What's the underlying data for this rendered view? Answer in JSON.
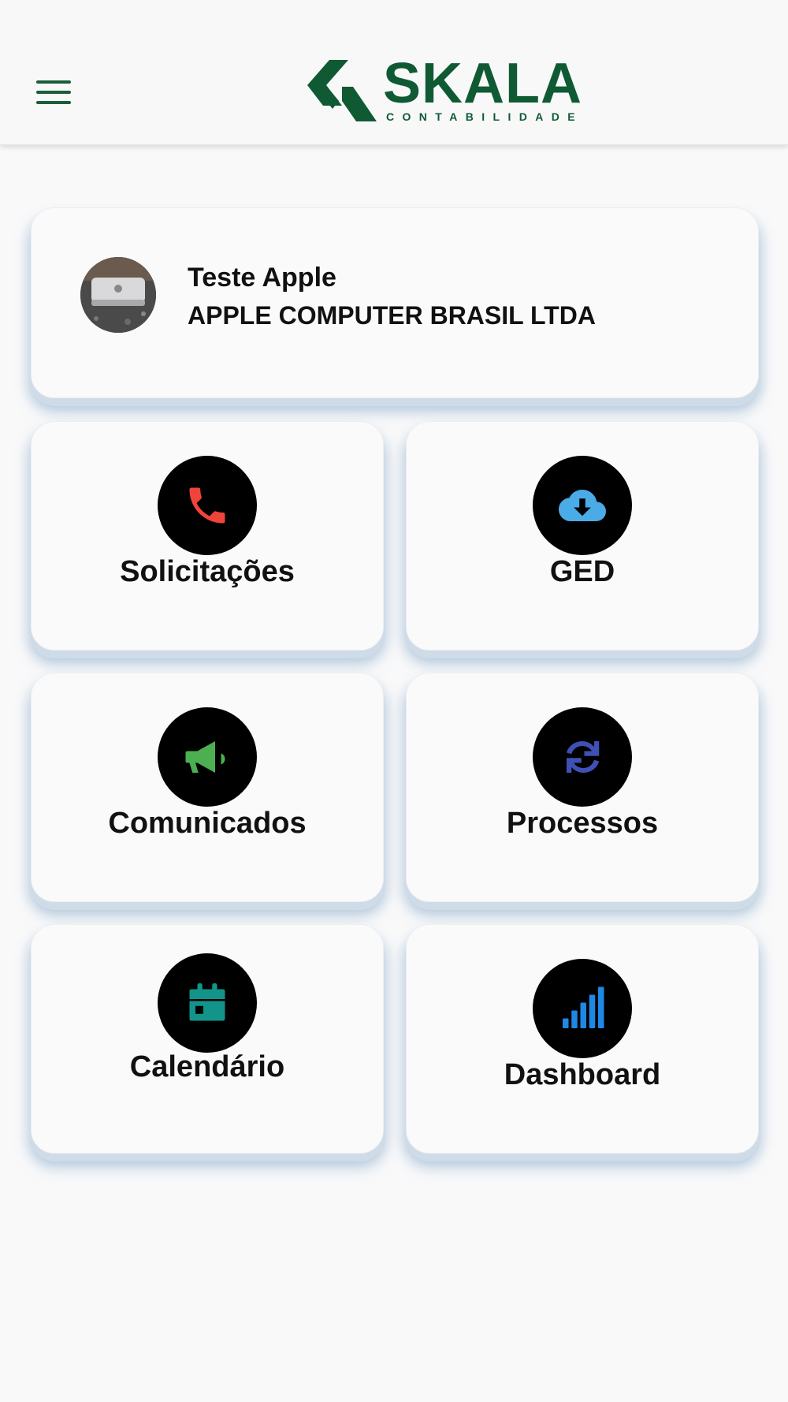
{
  "header": {
    "menu_icon": "hamburger-menu-icon",
    "logo": {
      "title": "SKALA",
      "subtitle": "CONTABILIDADE",
      "color": "#0f5a33"
    }
  },
  "profile": {
    "name": "Teste Apple",
    "company": "APPLE COMPUTER BRASIL LTDA",
    "avatar_icon": "mac-mini-photo"
  },
  "tiles": [
    {
      "label": "Solicitações",
      "icon": "phone-icon",
      "icon_color": "#f0443a"
    },
    {
      "label": "GED",
      "icon": "cloud-download-icon",
      "icon_color": "#4aabe6"
    },
    {
      "label": "Comunicados",
      "icon": "megaphone-icon",
      "icon_color": "#4caf50"
    },
    {
      "label": "Processos",
      "icon": "sync-icon",
      "icon_color": "#3f51b5"
    },
    {
      "label": "Calendário",
      "icon": "calendar-icon",
      "icon_color": "#13948a"
    },
    {
      "label": "Dashboard",
      "icon": "signal-bars-icon",
      "icon_color": "#1e88e5"
    }
  ]
}
